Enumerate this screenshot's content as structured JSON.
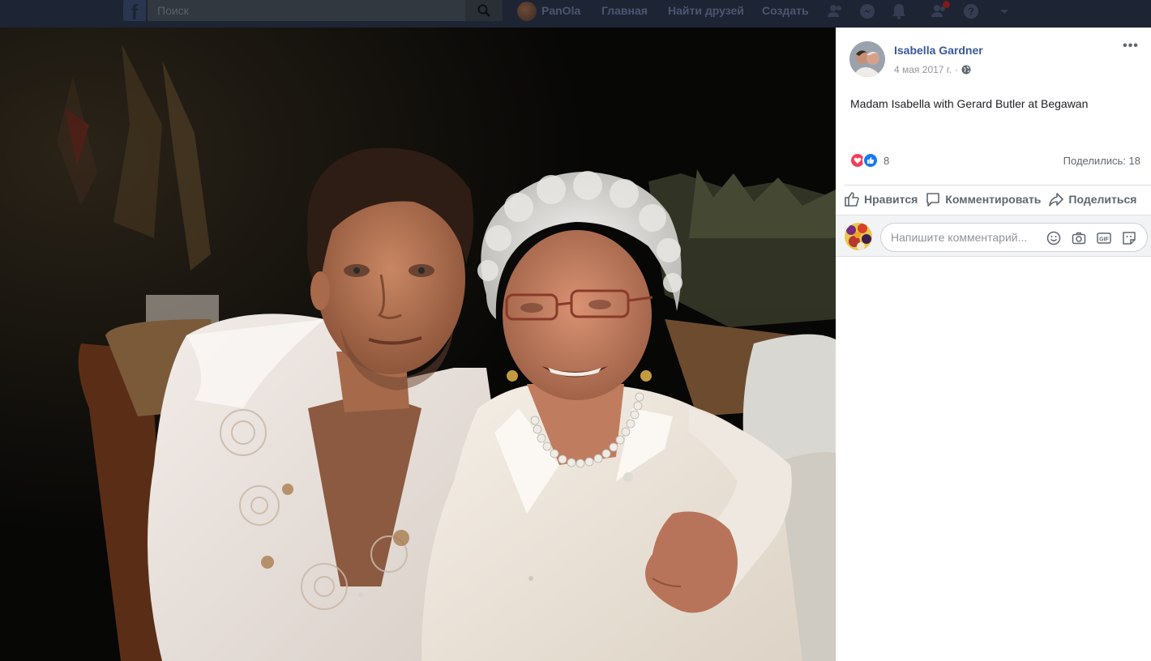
{
  "topbar": {
    "search_placeholder": "Поиск",
    "profile_name": "PanOla",
    "nav": [
      "Главная",
      "Найти друзей",
      "Создать"
    ]
  },
  "post": {
    "author": "Isabella Gardner",
    "date": "4 мая 2017 г.",
    "separator": "·",
    "more": "•••",
    "text": "Madam Isabella with Gerard Butler at Begawan",
    "reactions_count": "8",
    "shares": "Поделились: 18"
  },
  "actions": {
    "like": "Нравится",
    "comment": "Комментировать",
    "share": "Поделиться"
  },
  "comment_box": {
    "placeholder": "Напишите комментарий..."
  },
  "icons": [
    "facebook-logo",
    "search-icon",
    "friends-icon",
    "messenger-icon",
    "notifications-icon",
    "help-icon",
    "dropdown-icon",
    "globe-icon",
    "like-icon",
    "comment-icon",
    "share-icon",
    "emoji-icon",
    "camera-icon",
    "gif-icon",
    "sticker-icon"
  ],
  "colors": {
    "author_link": "#385898",
    "love": "#f33e58",
    "like": "#1877f2",
    "topbar": "#1d2433"
  }
}
